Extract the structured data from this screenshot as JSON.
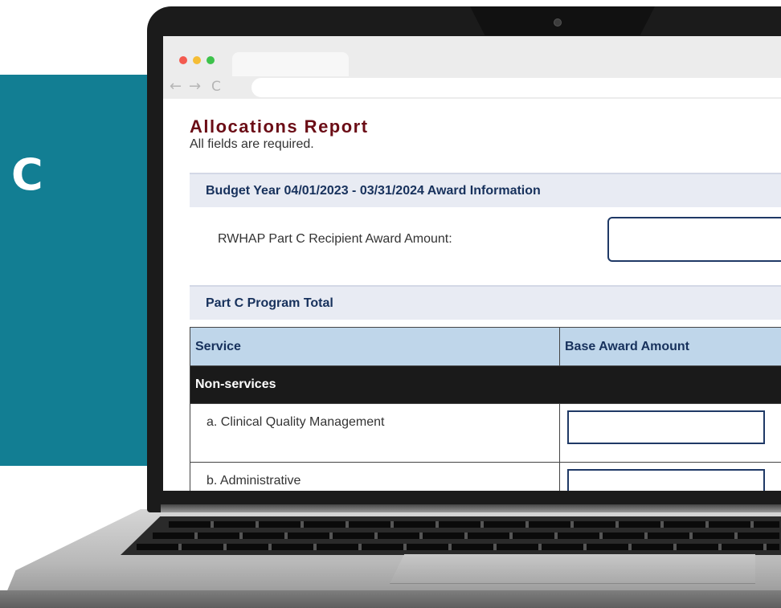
{
  "side_panel": {
    "letter": "C"
  },
  "page": {
    "title": "Allocations Report",
    "subtitle": "All fields are required."
  },
  "award_section": {
    "heading": "Budget Year 04/01/2023 - 03/31/2024 Award Information",
    "recipient_label": "RWHAP Part C Recipient Award Amount:",
    "recipient_value": ""
  },
  "program_section": {
    "heading": "Part C Program Total"
  },
  "table": {
    "columns": [
      "Service",
      "Base Award Amount"
    ],
    "group_label": "Non-services",
    "rows": [
      {
        "label": "a. Clinical Quality Management",
        "value": ""
      },
      {
        "label": "b. Administrative",
        "value": ""
      }
    ]
  },
  "browser": {
    "back_icon": "left-arrow-icon",
    "forward_icon": "right-arrow-icon",
    "reload_icon": "reload-icon"
  },
  "colors": {
    "side_panel": "#127e93",
    "title": "#6b0d16",
    "section_bar": "#e8ebf3",
    "table_header": "#bfd6ea",
    "group_row": "#1a1a1a"
  }
}
